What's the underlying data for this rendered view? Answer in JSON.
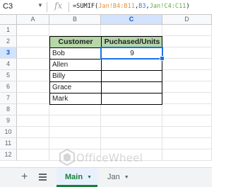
{
  "name_box": "C3",
  "formula_bar": {
    "fx_label": "fx",
    "prefix": "=SUMIF(",
    "range1": "Jan!B4:B11",
    "comma1": ",",
    "criterion": "B3",
    "comma2": ",",
    "range2": "Jan!C4:C11",
    "suffix": ")"
  },
  "columns": [
    "A",
    "B",
    "C",
    "D"
  ],
  "selected_column": "C",
  "rows": [
    "1",
    "2",
    "3",
    "4",
    "5",
    "6",
    "7",
    "8",
    "9",
    "10",
    "11",
    "12"
  ],
  "selected_row": "3",
  "table": {
    "headers": [
      "Customer",
      "Puchased/Units"
    ],
    "rows": [
      [
        "Bob",
        "9"
      ],
      [
        "Allen",
        ""
      ],
      [
        "Billy",
        ""
      ],
      [
        "Grace",
        ""
      ],
      [
        "Mark",
        ""
      ]
    ],
    "header_color": "#b6d7a8"
  },
  "watermark": "OfficeWheel",
  "sheet_tabs": [
    {
      "label": "Main",
      "active": true
    },
    {
      "label": "Jan",
      "active": false
    }
  ],
  "colors": {
    "selection": "#1a73e8",
    "active_tab": "#188038"
  }
}
